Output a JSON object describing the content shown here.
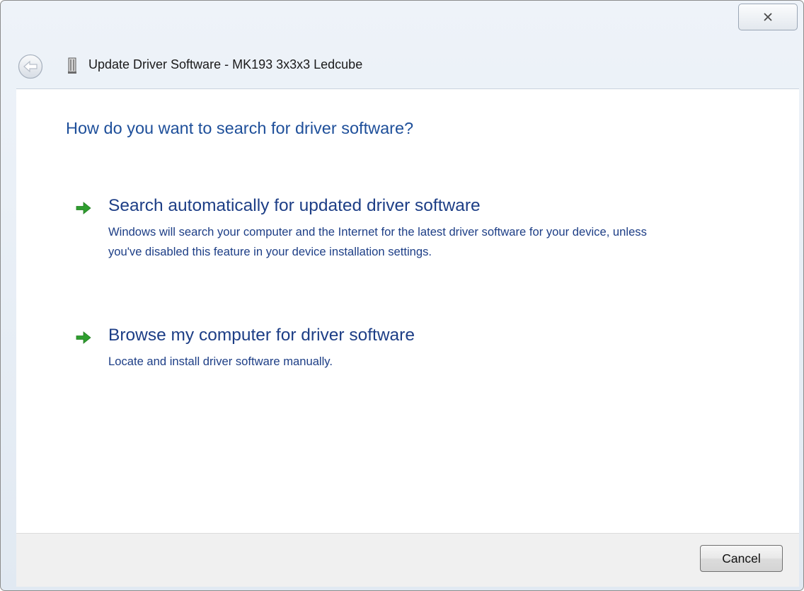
{
  "window": {
    "title": "Update Driver Software - MK193 3x3x3 Ledcube"
  },
  "icons": {
    "close": "close-icon",
    "back": "back-arrow-icon",
    "device": "usb-device-icon",
    "option_arrow": "green-arrow-icon"
  },
  "colors": {
    "heading": "#1e4f9a",
    "link": "#1d3e86",
    "arrow": "#2e9e2e"
  },
  "main": {
    "heading": "How do you want to search for driver software?",
    "options": [
      {
        "title": "Search automatically for updated driver software",
        "description": "Windows will search your computer and the Internet for the latest driver software for your device, unless you've disabled this feature in your device installation settings."
      },
      {
        "title": "Browse my computer for driver software",
        "description": "Locate and install driver software manually."
      }
    ]
  },
  "footer": {
    "cancel_label": "Cancel"
  }
}
